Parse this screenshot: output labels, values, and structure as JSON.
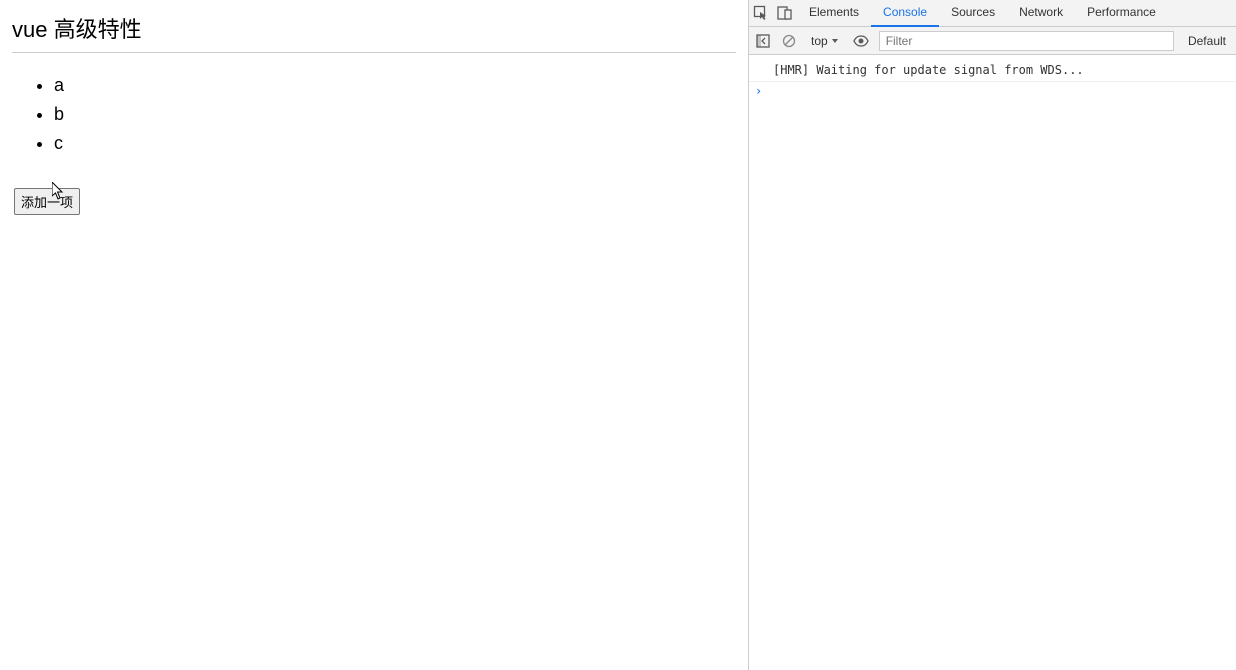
{
  "page": {
    "title": "vue 高级特性",
    "items": [
      "a",
      "b",
      "c"
    ],
    "add_button_label": "添加一项"
  },
  "devtools": {
    "tabs": {
      "elements": "Elements",
      "console": "Console",
      "sources": "Sources",
      "network": "Network",
      "performance": "Performance"
    },
    "toolbar": {
      "context_label": "top",
      "filter_placeholder": "Filter",
      "levels_label": "Default"
    },
    "console": {
      "log_text": "[HMR] Waiting for update signal from WDS..."
    }
  }
}
